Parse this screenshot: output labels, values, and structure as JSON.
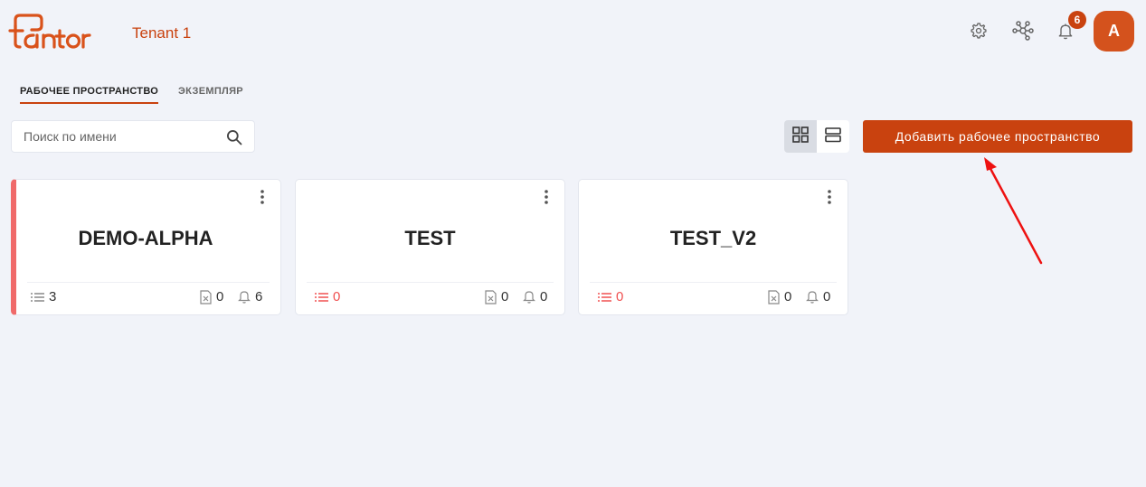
{
  "header": {
    "logo_text": "tantor",
    "tenant": "Tenant 1",
    "notifications_count": "6",
    "avatar_initial": "A",
    "icons": [
      "gear-icon",
      "network-icon",
      "bell-icon"
    ]
  },
  "tabs": [
    {
      "label": "РАБОЧЕЕ ПРОСТРАНСТВО",
      "active": true
    },
    {
      "label": "ЭКЗЕМПЛЯР",
      "active": false
    }
  ],
  "search": {
    "placeholder": "Поиск по имени",
    "value": ""
  },
  "toolbar": {
    "add_label": "Добавить рабочее пространство",
    "view_mode": "grid"
  },
  "cards": [
    {
      "title": "DEMO-ALPHA",
      "list_count": "3",
      "files_count": "0",
      "alerts_count": "6",
      "alert_stripe": true
    },
    {
      "title": "TEST",
      "list_count": "0",
      "files_count": "0",
      "alerts_count": "0",
      "alert_stripe": false
    },
    {
      "title": "TEST_V2",
      "list_count": "0",
      "files_count": "0",
      "alerts_count": "0",
      "alert_stripe": false
    }
  ],
  "colors": {
    "accent": "#c9420f",
    "background": "#f1f3f9",
    "alert": "#f05050"
  }
}
